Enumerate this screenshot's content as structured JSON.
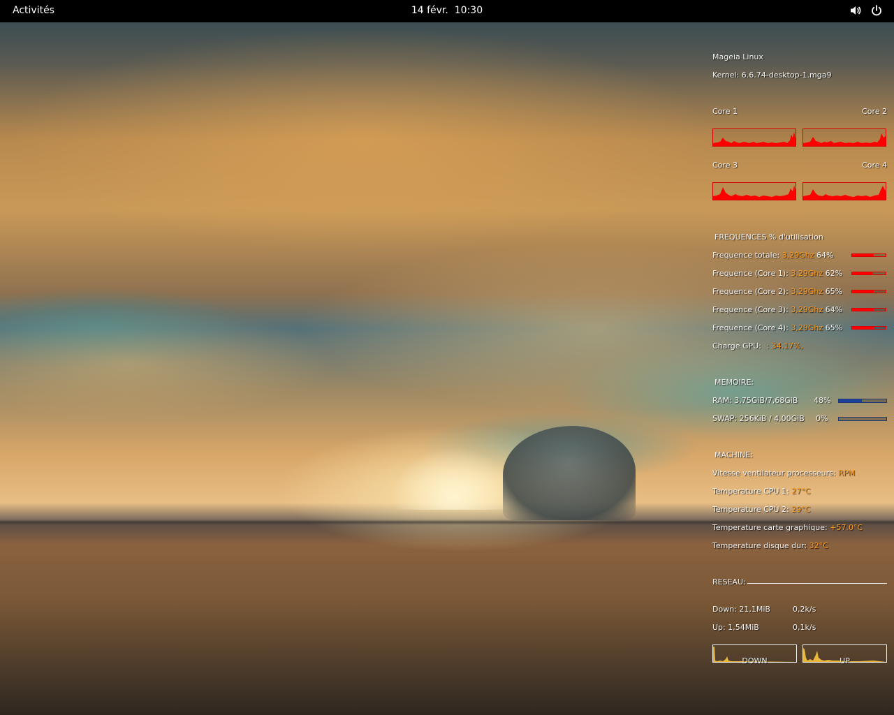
{
  "topbar": {
    "activities": "Activités",
    "clock": "14 févr.  10:30",
    "icons": [
      "volume-icon",
      "power-icon"
    ]
  },
  "conky": {
    "distro": "Mageia Linux",
    "kernel": "Kernel: 6.6.74-desktop-1.mga9",
    "cores": {
      "core1": "Core 1",
      "core2": "Core 2",
      "core3": "Core 3",
      "core4": "Core 4"
    },
    "freq_header": "FREQUENCES % d'utilisation",
    "freqs": [
      {
        "label": "Frequence totale:",
        "value": "3,29Ghz",
        "pct": "64%",
        "level": 64
      },
      {
        "label": "Frequence (Core 1):",
        "value": "3,29Ghz",
        "pct": "62%",
        "level": 62
      },
      {
        "label": "Frequence (Core 2):",
        "value": "3,29Ghz",
        "pct": "65%",
        "level": 65
      },
      {
        "label": "Frequence (Core 3):",
        "value": "3,29Ghz",
        "pct": "64%",
        "level": 64
      },
      {
        "label": "Frequence (Core 4):",
        "value": "3,29Ghz",
        "pct": "65%",
        "level": 65
      }
    ],
    "gpu": {
      "label": "Charge GPU:",
      "value": ": 34.17%,"
    },
    "mem_header": "MEMOIRE:",
    "ram": {
      "label": "RAM: 3,75GiB/7,68GiB",
      "pct": "48%",
      "level": 48
    },
    "swap": {
      "label": "SWAP: 256KiB / 4,00GiB",
      "pct": "0%",
      "level": 0
    },
    "machine_header": "MACHINE:",
    "machine": [
      {
        "label": "Vitesse ventilateur processeurs:",
        "value": "RPM"
      },
      {
        "label": "Temperature CPU 1:",
        "value": "27°C"
      },
      {
        "label": "Temperature CPU 2:",
        "value": "29°C"
      },
      {
        "label": "Temperature carte graphique:",
        "value": "+57.0°C"
      },
      {
        "label": "Temperature disque dur:",
        "value": "32°C"
      }
    ],
    "net_header": "RESEAU:",
    "down": {
      "label": "Down: 21,1MiB",
      "rate": "0,2k/s"
    },
    "up": {
      "label": "Up: 1,54MiB",
      "rate": "0,1k/s"
    },
    "graph_down": "DOWN",
    "graph_up": "UP",
    "colors": {
      "text": "#f2f2f2",
      "accent": "#ff9b1e",
      "cpu_graph": "#ff0000",
      "mem_bar": "#1a3fa0",
      "net_graph": "#e8b83a"
    }
  }
}
